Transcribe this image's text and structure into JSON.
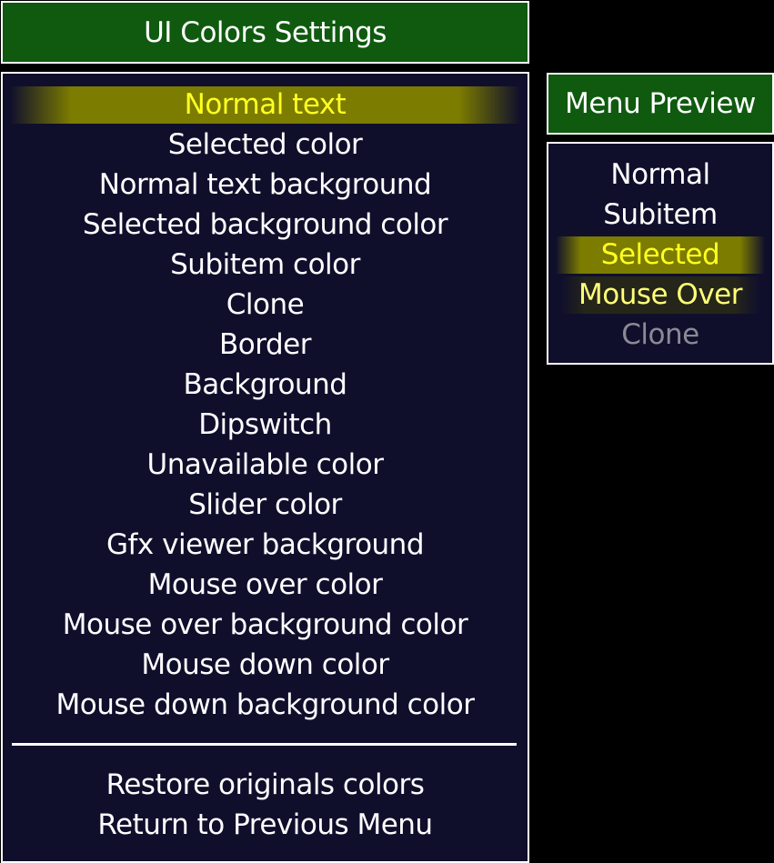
{
  "main": {
    "title": "UI Colors Settings",
    "items": [
      {
        "label": "Normal text",
        "selected": true
      },
      {
        "label": "Selected color"
      },
      {
        "label": "Normal text background"
      },
      {
        "label": "Selected background color"
      },
      {
        "label": "Subitem color"
      },
      {
        "label": "Clone"
      },
      {
        "label": "Border"
      },
      {
        "label": "Background"
      },
      {
        "label": "Dipswitch"
      },
      {
        "label": "Unavailable color"
      },
      {
        "label": "Slider color"
      },
      {
        "label": "Gfx viewer background"
      },
      {
        "label": "Mouse over color"
      },
      {
        "label": "Mouse over background color"
      },
      {
        "label": "Mouse down color"
      },
      {
        "label": "Mouse down background color"
      }
    ],
    "actions": [
      {
        "label": "Restore originals colors"
      },
      {
        "label": "Return to Previous Menu"
      }
    ]
  },
  "preview": {
    "title": "Menu Preview",
    "items": [
      {
        "label": "Normal",
        "state": "normal"
      },
      {
        "label": "Subitem",
        "state": "subitem"
      },
      {
        "label": "Selected",
        "state": "selected"
      },
      {
        "label": "Mouse Over",
        "state": "mouse-over"
      },
      {
        "label": "Clone",
        "state": "clone"
      }
    ]
  },
  "colors": {
    "title_background": "#0f5a0f",
    "panel_background": "#0f0f2c",
    "border": "#ffffff",
    "normal_text": "#ffffff",
    "selected_text": "#ffff22",
    "selected_background": "#7c7c00",
    "mouse_over_text": "#ffff77",
    "mouse_over_background": "#25251a",
    "clone_text": "#8a8a96"
  }
}
